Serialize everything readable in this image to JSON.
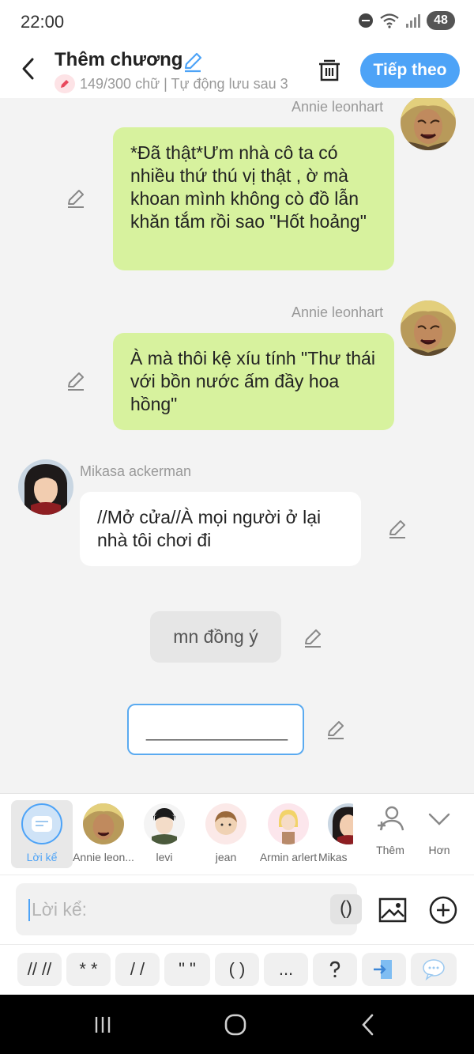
{
  "status_bar": {
    "time": "22:00",
    "battery": "48"
  },
  "header": {
    "title": "Thêm chương",
    "subtitle": "149/300 chữ | Tự động lưu sau 3",
    "next_label": "Tiếp theo"
  },
  "messages": [
    {
      "sender": "Annie leonhart",
      "side": "right",
      "text": "*Đã thật*Ưm nhà cô ta có nhiều thứ thú vị thật , ờ mà khoan mình không cò đồ lẫn khăn tắm rồi sao \"Hốt hoảng\""
    },
    {
      "sender": "Annie leonhart",
      "side": "right",
      "text": "À mà thôi kệ xíu tính \"Thư thái với bồn nước ấm đầy hoa hồng\""
    },
    {
      "sender": "Mikasa ackerman",
      "side": "left",
      "text": "//Mở cửa//À mọi người ở lại nhà tôi chơi đi"
    },
    {
      "sender": "",
      "side": "center",
      "text": "mn đồng ý"
    },
    {
      "sender": "",
      "side": "center-input",
      "text": "______________"
    }
  ],
  "characters": [
    {
      "label": "Lời kể",
      "active": true,
      "icon": "narration-icon"
    },
    {
      "label": "Annie leon...",
      "active": false,
      "icon": "annie-avatar"
    },
    {
      "label": "levi",
      "active": false,
      "icon": "levi-avatar"
    },
    {
      "label": "jean",
      "active": false,
      "icon": "jean-avatar"
    },
    {
      "label": "Armin arlert",
      "active": false,
      "icon": "armin-avatar"
    },
    {
      "label": "Mikas",
      "active": false,
      "icon": "mikasa-avatar"
    }
  ],
  "more_character_label": "Thêm",
  "more_label": "Hơn",
  "input": {
    "placeholder": "Lời kể:",
    "paren_chip": "()"
  },
  "quick_symbols": [
    "// //",
    "* *",
    "/ /",
    "\" \"",
    "( )",
    "..."
  ],
  "colors": {
    "accent": "#4da3f7",
    "bubble_right": "#d7f29e",
    "bubble_left": "#ffffff",
    "nav_bar": "#000000"
  }
}
